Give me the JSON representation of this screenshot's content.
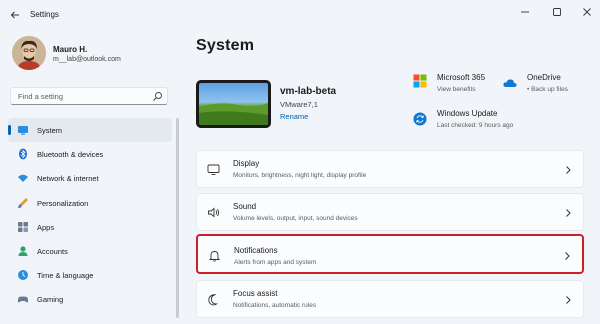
{
  "window": {
    "title": "Settings"
  },
  "profile": {
    "name": "Mauro H.",
    "email": "m__lab@outlook.com"
  },
  "search": {
    "placeholder": "Find a setting"
  },
  "nav": {
    "items": [
      {
        "label": "System",
        "icon": "monitor-icon",
        "active": true
      },
      {
        "label": "Bluetooth & devices",
        "icon": "bluetooth-icon"
      },
      {
        "label": "Network & internet",
        "icon": "wifi-icon"
      },
      {
        "label": "Personalization",
        "icon": "brush-icon"
      },
      {
        "label": "Apps",
        "icon": "apps-icon"
      },
      {
        "label": "Accounts",
        "icon": "person-icon"
      },
      {
        "label": "Time & language",
        "icon": "globe-clock-icon"
      },
      {
        "label": "Gaming",
        "icon": "gamepad-icon"
      }
    ]
  },
  "page": {
    "title": "System"
  },
  "device": {
    "name": "vm-lab-beta",
    "model": "VMware7,1",
    "rename": "Rename"
  },
  "quick_info": {
    "microsoft365": {
      "title": "Microsoft 365",
      "sub": "View benefits"
    },
    "onedrive": {
      "title": "OneDrive",
      "sub": "• Back up files"
    },
    "windows_update": {
      "title": "Windows Update",
      "sub": "Last checked: 9 hours ago"
    }
  },
  "cards": [
    {
      "title": "Display",
      "sub": "Monitors, brightness, night light, display profile",
      "icon": "display-icon"
    },
    {
      "title": "Sound",
      "sub": "Volume levels, output, input, sound devices",
      "icon": "speaker-icon"
    },
    {
      "title": "Notifications",
      "sub": "Alerts from apps and system",
      "icon": "bell-icon",
      "highlighted": true
    },
    {
      "title": "Focus assist",
      "sub": "Notifications, automatic rules",
      "icon": "moon-icon"
    }
  ],
  "colors": {
    "accent": "#0067c0",
    "highlight_border": "#c9202b",
    "link": "#005fb8"
  }
}
